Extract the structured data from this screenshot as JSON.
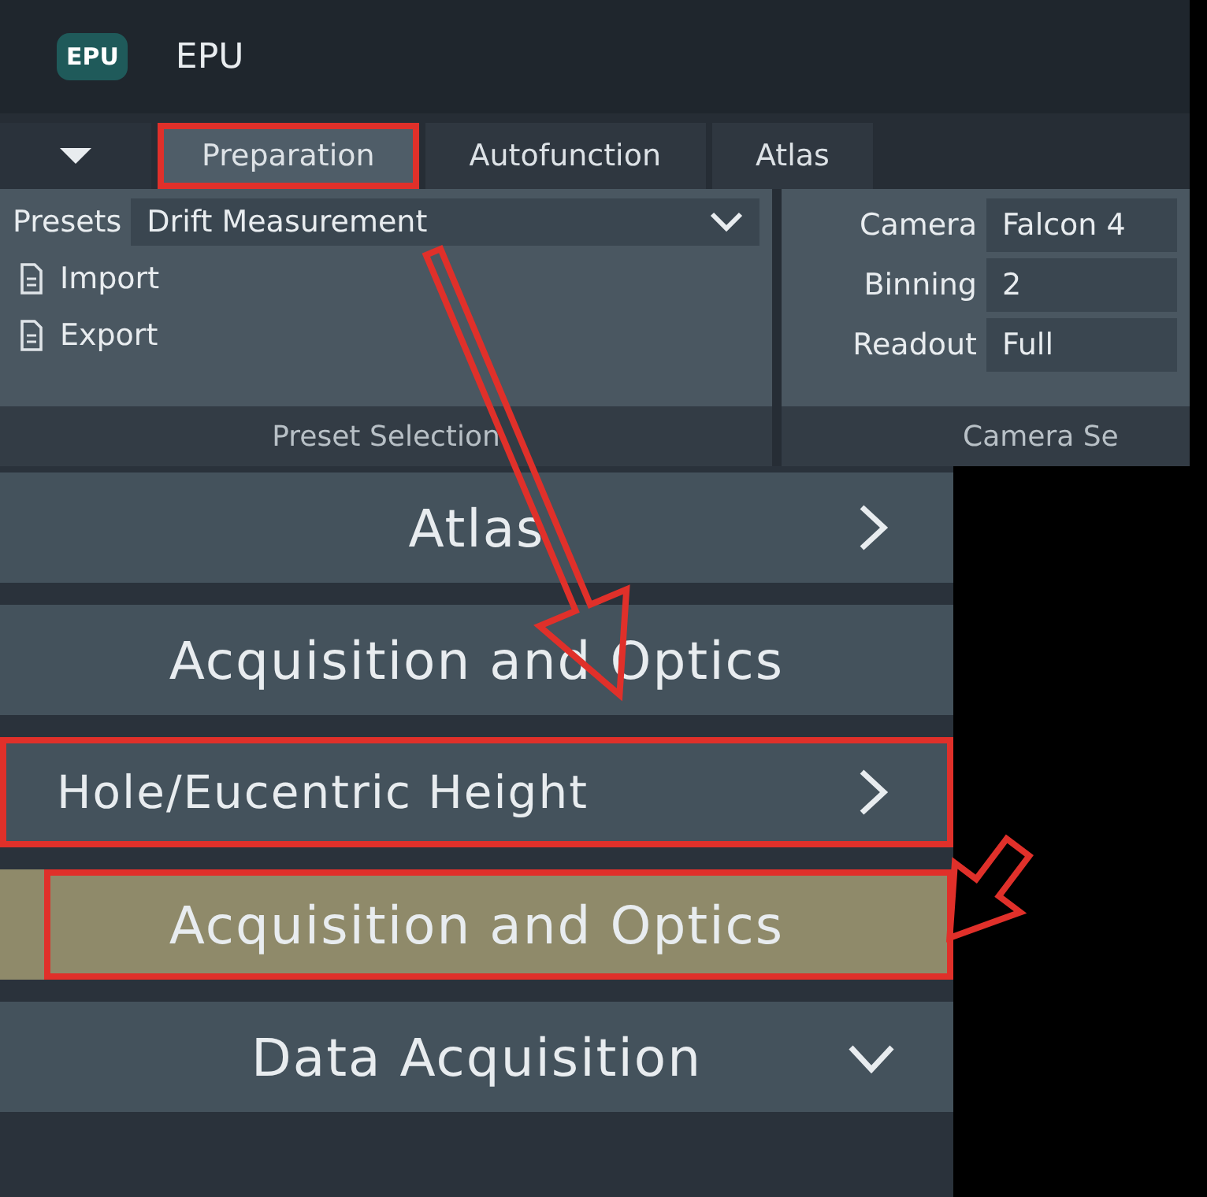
{
  "window": {
    "title": "EPU",
    "logo": "EPU"
  },
  "tabs": [
    {
      "label": "Preparation",
      "selected": true,
      "highlighted": true
    },
    {
      "label": "Autofunction",
      "selected": false,
      "highlighted": false
    },
    {
      "label": "Atlas",
      "selected": false,
      "highlighted": false
    }
  ],
  "preset_group": {
    "presets_label": "Presets",
    "preset_value": "Drift Measurement",
    "actions": [
      {
        "label": "Import"
      },
      {
        "label": "Export"
      }
    ],
    "group_label": "Preset Selection"
  },
  "camera_group": {
    "fields": [
      {
        "label": "Camera",
        "value": "Falcon 4"
      },
      {
        "label": "Binning",
        "value": "2"
      },
      {
        "label": "Readout",
        "value": "Full"
      }
    ],
    "group_label": "Camera Se"
  },
  "sidebar": {
    "items": [
      {
        "label": "Atlas",
        "kind": "section",
        "expanded": false,
        "selected": false,
        "highlighted": false
      },
      {
        "label": "Acquisition and Optics",
        "kind": "section",
        "selected": false,
        "highlighted": false
      },
      {
        "label": "Hole/Eucentric Height",
        "kind": "step",
        "expanded": false,
        "selected": false,
        "highlighted": true
      },
      {
        "label": "Acquisition and Optics",
        "kind": "section",
        "selected": true,
        "highlighted": true
      },
      {
        "label": "Data Acquisition",
        "kind": "section",
        "expanded": true,
        "selected": false,
        "highlighted": false
      }
    ]
  }
}
